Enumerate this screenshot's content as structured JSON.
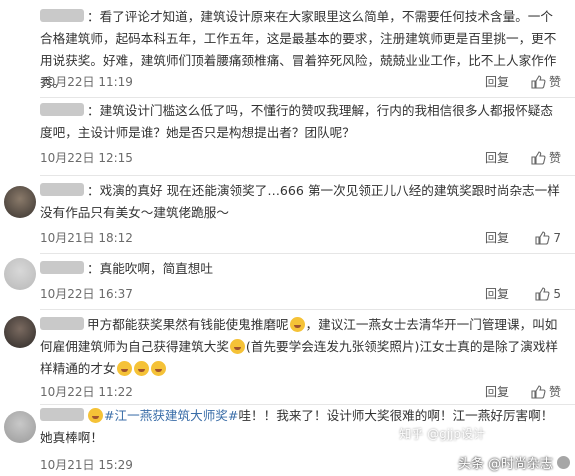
{
  "comments": [
    {
      "text": "：看了评论才知道，建筑设计原来在大家眼里这么简单，不需要任何技术含量。一个合格建筑师，起码本科五年，工作五年，这是最基本的要求，注册建筑师更是百里挑一，更不用说获奖。好难，建筑师们顶着腰痛颈椎痛、冒着猝死风险，兢兢业业工作，比不上人家作作秀。",
      "time": "10月22日 11:19",
      "reply": "回复",
      "likes": "赞"
    },
    {
      "text": "：建筑设计门槛这么低了吗，不懂行的赞叹我理解，行内的我相信很多人都报怀疑态度吧，主设计师是谁？她是否只是构想提出者？团队呢？",
      "time": "10月22日 12:15",
      "reply": "回复",
      "likes": "赞"
    },
    {
      "text": "：戏演的真好 现在还能演领奖了…666 第一次见领正儿八经的建筑奖跟时尚杂志一样没有作品只有美女～建筑佬跪服～",
      "time": "10月21日 18:12",
      "reply": "回复",
      "likes": "7"
    },
    {
      "text": "：真能吹啊，简直想吐",
      "time": "10月22日 16:37",
      "reply": "回复",
      "likes": "5"
    },
    {
      "text_a": "甲方都能获奖果然有钱能使鬼推磨呢",
      "text_b": "，建议江一燕女士去清华开一门管理课，叫如何雇佣建筑师为自己获得建筑大奖",
      "text_c": "(首先要学会连发九张领奖照片)江女士真的是除了演戏样样精通的才女",
      "time": "10月22日 11:22",
      "reply": "回复",
      "likes": "赞"
    },
    {
      "tag": "#江一燕获建筑大师奖#",
      "text": "哇！！我来了！设计师大奖很难的啊！江一燕好厉害啊！她真棒啊！",
      "time": "10月21日 15:29"
    }
  ],
  "watermark": {
    "main": "头条 @时尚杂志",
    "secondary": "知乎 @gjjp设计"
  }
}
